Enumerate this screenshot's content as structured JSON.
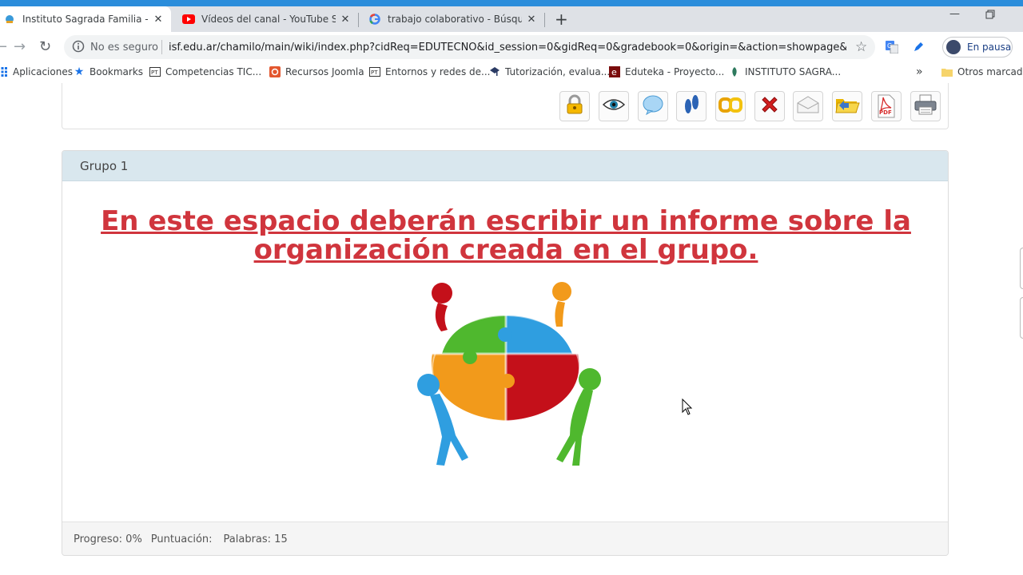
{
  "browser": {
    "tabs": [
      {
        "label": "Instituto Sagrada Familia -Cosquí",
        "active": true,
        "favicon": "institute-favicon"
      },
      {
        "label": "Vídeos del canal - YouTube Studio",
        "active": false,
        "favicon": "youtube-favicon"
      },
      {
        "label": "trabajo colaborativo - Búsqueda",
        "active": false,
        "favicon": "google-favicon"
      }
    ],
    "new_tab_label": "+",
    "security_label": "No es seguro",
    "url": "isf.edu.ar/chamilo/main/wiki/index.php?cidReq=EDUTECNO&id_session=0&gidReq=0&gradebook=0&origin=&action=showpage&action...",
    "profile_label": "En pausa",
    "bookmarks": [
      {
        "label": "Aplicaciones",
        "icon": "apps-grid-icon"
      },
      {
        "label": "Bookmarks",
        "icon": "star-icon"
      },
      {
        "label": "Competencias TIC...",
        "icon": "pt-icon"
      },
      {
        "label": "Recursos Joomla",
        "icon": "joomla-icon"
      },
      {
        "label": "Entornos y redes de...",
        "icon": "pt-icon"
      },
      {
        "label": "Tutorización, evalua...",
        "icon": "cap-icon"
      },
      {
        "label": "Eduteka - Proyecto...",
        "icon": "eduteka-icon"
      },
      {
        "label": "INSTITUTO SAGRA...",
        "icon": "institute-icon"
      }
    ],
    "more_bookmarks": "»",
    "other_bookmarks": "Otros marcadores"
  },
  "wiki": {
    "actions": [
      {
        "name": "edit-page-button",
        "icon": "pencil-icon"
      },
      {
        "name": "lock-button",
        "icon": "lock-icon"
      },
      {
        "name": "visibility-button",
        "icon": "eye-icon"
      },
      {
        "name": "discuss-button",
        "icon": "comment-icon"
      },
      {
        "name": "history-button",
        "icon": "footprints-icon"
      },
      {
        "name": "links-button",
        "icon": "links-icon"
      },
      {
        "name": "delete-button",
        "icon": "delete-icon"
      },
      {
        "name": "notify-button",
        "icon": "envelope-icon"
      },
      {
        "name": "export-button",
        "icon": "folder-icon"
      },
      {
        "name": "pdf-button",
        "icon": "pdf-icon"
      },
      {
        "name": "print-button",
        "icon": "printer-icon"
      }
    ],
    "pdf_label": "PDF",
    "group_title": "Grupo 1",
    "heading": "En este espacio deberán escribir un informe sobre la organización creada en el grupo.",
    "footer": {
      "progress": "Progreso: 0%",
      "score": "Puntuación:",
      "words": "Palabras: 15"
    }
  },
  "colors": {
    "heading": "#d0353d",
    "panel_header": "#d9e7ee",
    "browser_accent": "#2b8ddb"
  }
}
